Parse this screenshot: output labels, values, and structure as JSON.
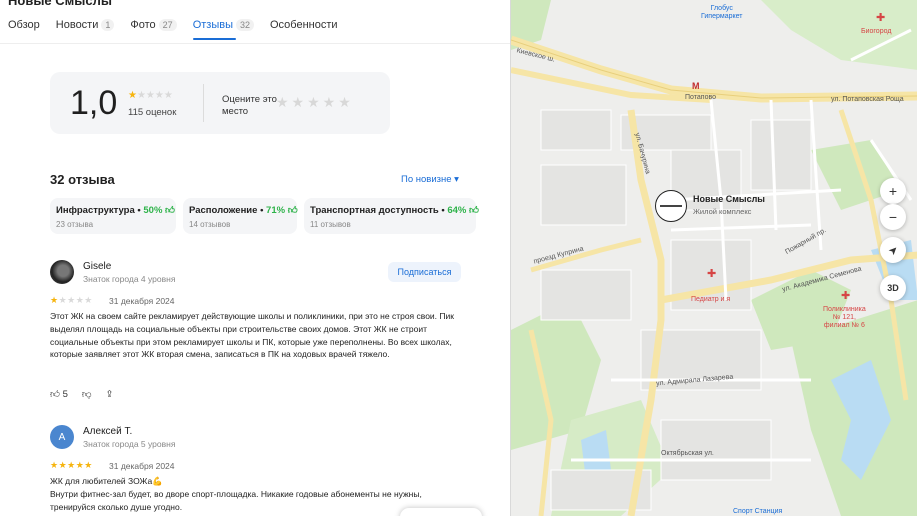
{
  "org": {
    "title": "Новые Смыслы"
  },
  "tabs": [
    {
      "label": "Обзор",
      "count": ""
    },
    {
      "label": "Новости",
      "count": "1"
    },
    {
      "label": "Фото",
      "count": "27"
    },
    {
      "label": "Отзывы",
      "count": "32"
    },
    {
      "label": "Особенности",
      "count": ""
    }
  ],
  "rating": {
    "value": "1,0",
    "stars": 1,
    "count_label": "115 оценок",
    "rate_prompt": "Оцените это место"
  },
  "reviews_header": {
    "title": "32 отзыва",
    "sort_label": "По новизне ▾"
  },
  "aspects": [
    {
      "name": "Инфраструктура",
      "percent": "50%",
      "sub": "23 отзыва"
    },
    {
      "name": "Расположение",
      "percent": "71%",
      "sub": "14 отзывов"
    },
    {
      "name": "Транспортная доступность",
      "percent": "64%",
      "sub": "11 отзывов"
    }
  ],
  "reviews": [
    {
      "author": "Gisele",
      "author_sub": "Знаток города 4 уровня",
      "subscribe_label": "Подписаться",
      "stars": 1,
      "date": "31 декабря 2024",
      "text": "Этот ЖК на своем сайте рекламирует действующие школы и поликлиники, при это не строя свои. Пик выделял площадь на социальные объекты при строительстве своих домов. Этот ЖК не строит социальные объекты при этом рекламирует школы и ПК, которые уже переполнены. Во всех школах, которые заявляет этот ЖК вторая смена, записаться в ПК на ходовых врачей тяжело.",
      "likes": "5"
    },
    {
      "author": "Алексей Т.",
      "avatar_letter": "А",
      "author_sub": "Знаток города 5 уровня",
      "stars": 5,
      "date": "31 декабря 2024",
      "text": "ЖК для любителей ЗОЖа💪\nВнутри фитнес-зал будет, во дворе спорт-площадка. Никакие годовые абонементы не нужны, тренируйся сколько душе угодно."
    }
  ],
  "map": {
    "pin": {
      "name": "Новые Смыслы",
      "sub": "Жилой комплекс"
    },
    "controls": {
      "zoom_in": "+",
      "zoom_out": "−",
      "locate": "➤",
      "view3d": "3D"
    },
    "labels": {
      "globus": "Глобус\nГипермаркет",
      "biogorod": "Биогород",
      "potapovo": "Потапово",
      "potapovskaya": "ул. Потаповская Роща",
      "bashkirova": "ул. Бачурина",
      "kiev_hwy": "Киевское ш.",
      "kurkino": "проезд Куприна",
      "pediatr": "Педиатр и я",
      "polyclinic": "Поликлиника\n№ 121,\nфилиал № 6",
      "admirala": "ул. Адмирала Лазарева",
      "akad_semenova": "ул. Академика Семенова",
      "oktyabrskaya": "Октябрьская ул.",
      "sport": "Спорт Станция",
      "pozharnyi": "Пожарный пр."
    },
    "colors": {
      "road_major": "#f6e5a6",
      "park": "#cfe8bd",
      "water": "#b9dcf3",
      "poi": "#d64545",
      "metro": "#c12c2c"
    }
  }
}
